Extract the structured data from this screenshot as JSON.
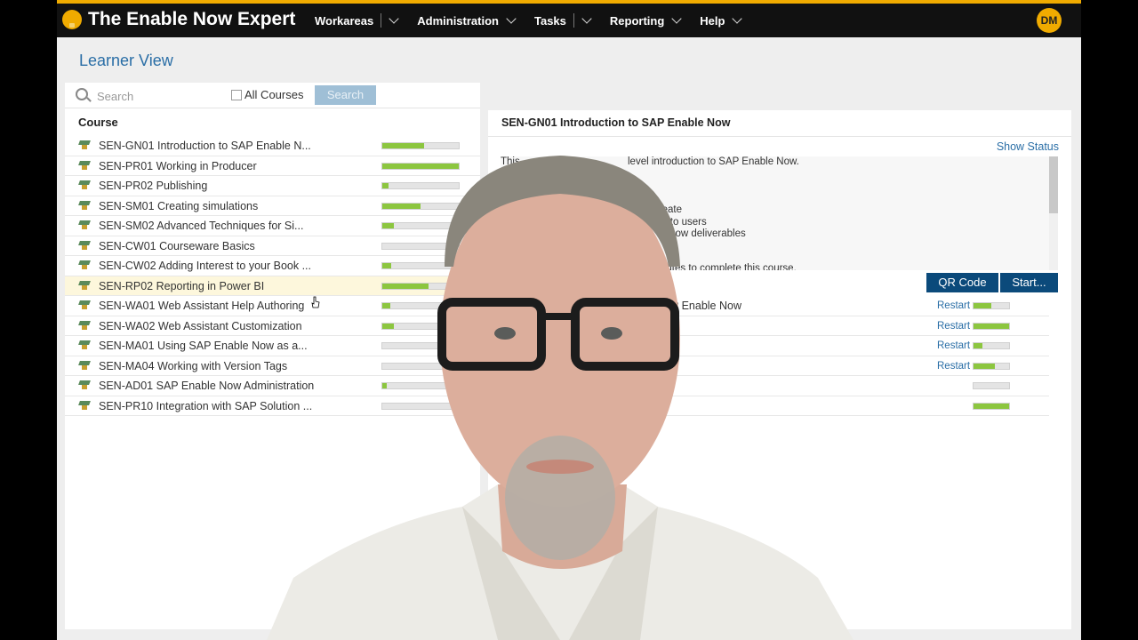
{
  "app": {
    "title": "The Enable Now Expert",
    "avatar_initials": "DM",
    "nav": [
      "Workareas",
      "Administration",
      "Tasks",
      "Reporting",
      "Help"
    ],
    "accent": "#f0ab00"
  },
  "page": {
    "title": "Learner View"
  },
  "search": {
    "placeholder": "Search",
    "all_courses_label": "All Courses",
    "button_label": "Search"
  },
  "course_list": {
    "header": "Course",
    "items": [
      {
        "label": "SEN-GN01 Introduction to SAP Enable N...",
        "progress": 0.55
      },
      {
        "label": "SEN-PR01 Working in Producer",
        "progress": 1.0
      },
      {
        "label": "SEN-PR02 Publishing",
        "progress": 0.08
      },
      {
        "label": "SEN-SM01 Creating simulations",
        "progress": 0.5
      },
      {
        "label": "SEN-SM02 Advanced Techniques for Si...",
        "progress": 0.15
      },
      {
        "label": "SEN-CW01 Courseware Basics",
        "progress": 0.0
      },
      {
        "label": "SEN-CW02 Adding Interest to your Book ...",
        "progress": 0.12
      },
      {
        "label": "SEN-RP02 Reporting in Power BI",
        "progress": 0.6,
        "highlighted": true
      },
      {
        "label": "SEN-WA01 Web Assistant Help Authoring",
        "progress": 0.1
      },
      {
        "label": "SEN-WA02 Web Assistant Customization",
        "progress": 0.15
      },
      {
        "label": "SEN-MA01 Using SAP Enable Now as a...",
        "progress": 0.0
      },
      {
        "label": "SEN-MA04 Working with Version Tags",
        "progress": 0.0
      },
      {
        "label": "SEN-AD01 SAP Enable Now Administration",
        "progress": 0.06
      },
      {
        "label": "SEN-PR10 Integration with SAP Solution ...",
        "progress": 0.0
      }
    ]
  },
  "detail": {
    "title": "SEN-GN01 Introduction to SAP Enable Now",
    "show_status": "Show Status",
    "description_lines": [
      "This",
      "level introduction to SAP Enable Now.",
      "create",
      "nt to users",
      "le Now deliverables",
      "nutes to complete this course."
    ],
    "qr_label": "QR Code",
    "start_label": "Start...",
    "lessons": [
      {
        "label": "P Enable Now",
        "restart": "Restart",
        "progress": 0.5
      },
      {
        "label": "",
        "restart": "Restart",
        "progress": 1.0
      },
      {
        "label": "",
        "restart": "Restart",
        "progress": 0.25
      },
      {
        "label": "",
        "restart": "Restart",
        "progress": 0.6
      },
      {
        "label": "",
        "restart": "",
        "progress": 0.0
      },
      {
        "label": "",
        "restart": "",
        "progress": 1.0
      }
    ]
  }
}
